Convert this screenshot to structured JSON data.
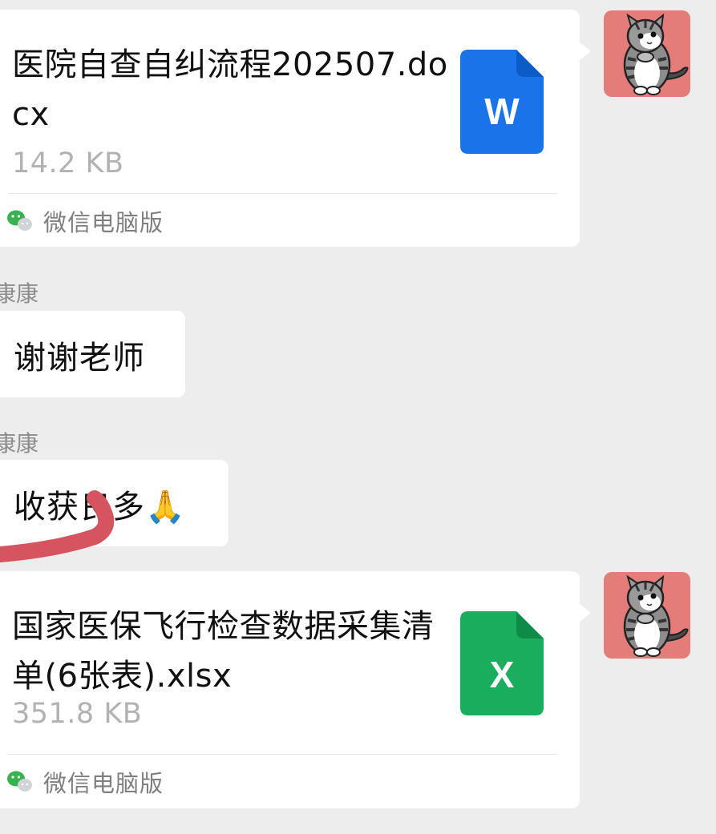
{
  "messages": [
    {
      "kind": "file",
      "filename": "医院自查自纠流程202507.docx",
      "size": "14.2 KB",
      "file_type_letter": "W",
      "icon_color": "#1a73e8",
      "source": "微信电脑版"
    },
    {
      "kind": "text",
      "sender": "康康",
      "text": "谢谢老师"
    },
    {
      "kind": "text",
      "sender": "康康",
      "text": "收获良多",
      "emoji": "🙏"
    },
    {
      "kind": "file",
      "filename": "国家医保飞行检查数据采集清单(6张表).xlsx",
      "size": "351.8 KB",
      "file_type_letter": "X",
      "icon_color": "#1aad5d",
      "source": "微信电脑版"
    }
  ],
  "icons": {
    "word_file": "word-document-icon",
    "excel_file": "excel-spreadsheet-icon",
    "source": "wechat-logo-icon",
    "avatar": "cat-avatar"
  },
  "colors": {
    "chat_background": "#ededed",
    "bubble": "#ffffff",
    "avatar_background": "#e47d7a",
    "scribble": "#d5545f"
  }
}
